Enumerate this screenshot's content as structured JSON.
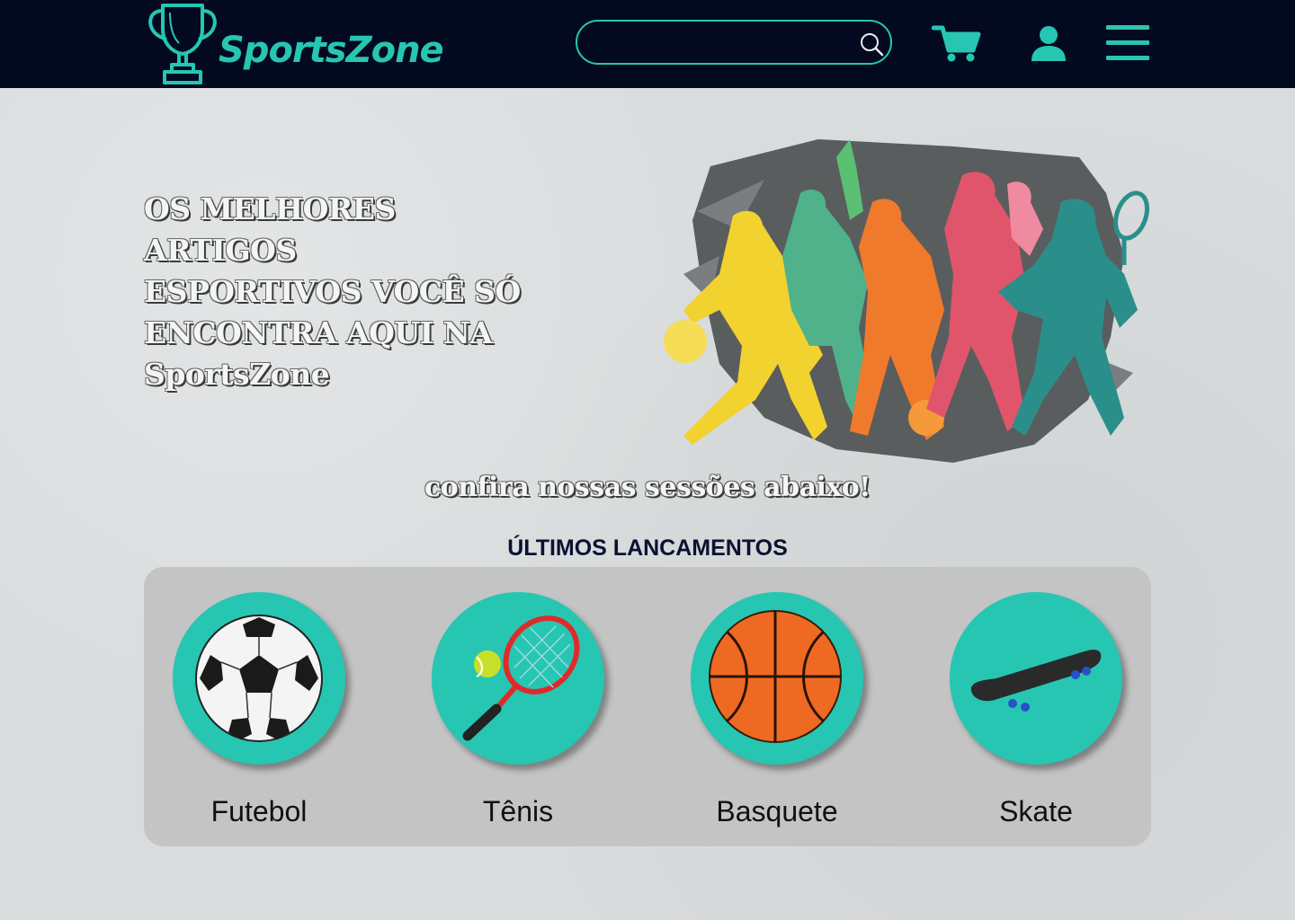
{
  "header": {
    "logo_text": "SportsZone",
    "search_placeholder": "",
    "icons": [
      "trophy-icon",
      "search-icon",
      "cart-icon",
      "user-icon",
      "menu-icon"
    ],
    "background_color": "#030a1f",
    "accent_color": "#26c6b3"
  },
  "hero": {
    "title_lines": [
      "OS MELHORES ARTIGOS",
      "ESPORTIVOS VOCÊ SÓ",
      "ENCONTRA AQUI NA",
      "SportsZone"
    ]
  },
  "subtitle": "confira nossas sessões abaixo!",
  "releases": {
    "title": "ÚLTIMOS LANCAMENTOS",
    "categories": [
      {
        "label": "Futebol",
        "icon": "soccer-ball-icon"
      },
      {
        "label": "Tênis",
        "icon": "tennis-racket-icon"
      },
      {
        "label": "Basquete",
        "icon": "basketball-icon"
      },
      {
        "label": "Skate",
        "icon": "skateboard-icon"
      }
    ]
  }
}
